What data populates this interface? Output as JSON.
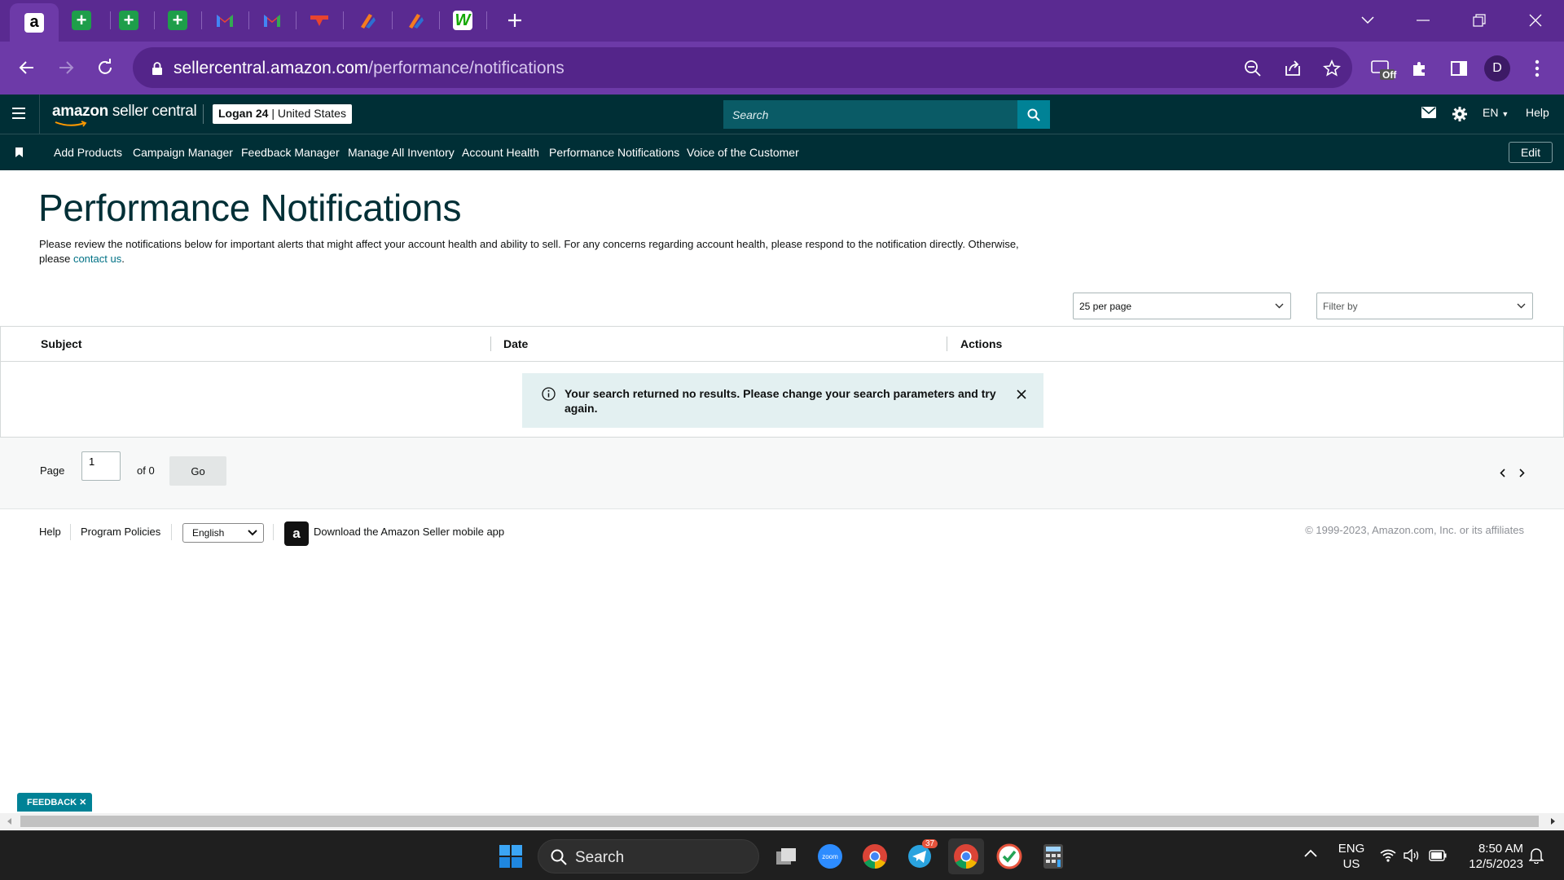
{
  "browser": {
    "tabs": [
      {
        "icon": "amazon-icon",
        "active": true
      },
      {
        "icon": "google-sheets-icon"
      },
      {
        "icon": "google-sheets-icon"
      },
      {
        "icon": "google-sheets-icon"
      },
      {
        "icon": "gmail-icon"
      },
      {
        "icon": "gmail-icon"
      },
      {
        "icon": "generic-site-icon"
      },
      {
        "icon": "generic-orange-icon"
      },
      {
        "icon": "generic-orange-icon"
      },
      {
        "icon": "upwork-icon"
      }
    ],
    "url_domain": "sellercentral.amazon.com",
    "url_path": "/performance/notifications",
    "profile_initial": "D",
    "extension_badge": "Off"
  },
  "header": {
    "logo_text_bold": "amazon",
    "logo_text": " seller central",
    "account_name": "Logan 24",
    "account_region": "United States",
    "search_placeholder": "Search",
    "language": "EN",
    "help": "Help"
  },
  "nav": {
    "items": [
      "Add Products",
      "Campaign Manager",
      "Feedback Manager",
      "Manage All Inventory",
      "Account Health",
      "Performance Notifications",
      "Voice of the Customer"
    ],
    "edit_label": "Edit"
  },
  "main": {
    "title": "Performance Notifications",
    "intro_text": "Please review the notifications below for important alerts that might affect your account health and ability to sell. For any concerns regarding account health, please respond to the notification directly. Otherwise, please",
    "intro_link": "contact us",
    "intro_end": ".",
    "per_page": "25 per page",
    "filter_placeholder": "Filter by",
    "table_headers": [
      "Subject",
      "Date",
      "Actions"
    ],
    "empty_message": "Your search returned no results. Please change your search parameters and try again.",
    "pager": {
      "page_label": "Page",
      "page_value": "1",
      "of_label": "of 0",
      "go_label": "Go"
    }
  },
  "footer": {
    "help": "Help",
    "program_policies": "Program Policies",
    "language": "English",
    "app_link": "Download the Amazon Seller mobile app",
    "copyright": "© 1999-2023, Amazon.com, Inc. or its affiliates"
  },
  "feedback_tab": "FEEDBACK ✕",
  "taskbar": {
    "search_label": "Search",
    "telegram_badge": "37",
    "lang_line1": "ENG",
    "lang_line2": "US",
    "time": "8:50 AM",
    "date": "12/5/2023"
  },
  "colors": {
    "browser_purple": "#6d3aa8",
    "seller_header": "#002f36",
    "link_teal": "#007185",
    "alert_bg": "#e3f0f1"
  }
}
